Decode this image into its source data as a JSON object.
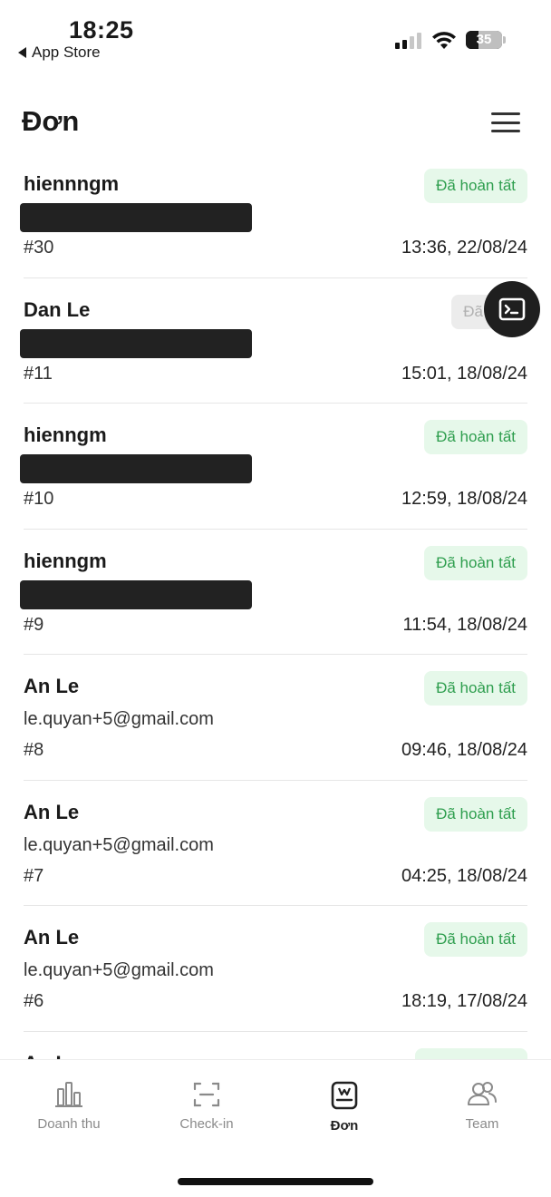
{
  "status_bar": {
    "time": "18:25",
    "back_app": "App Store",
    "battery": "35"
  },
  "header": {
    "title": "Đơn",
    "menu_icon": "hamburger-menu-icon"
  },
  "orders": [
    {
      "name": "hiennngm",
      "email": "",
      "email_redacted": true,
      "id": "#30",
      "time": "13:36, 22/08/24",
      "status": "Đã hoàn tất"
    },
    {
      "name": "Dan Le",
      "email": "",
      "email_redacted": true,
      "id": "#11",
      "time": "15:01, 18/08/24",
      "status": "Đã"
    },
    {
      "name": "hienngm",
      "email": "",
      "email_redacted": true,
      "id": "#10",
      "time": "12:59, 18/08/24",
      "status": "Đã hoàn tất"
    },
    {
      "name": "hienngm",
      "email": "",
      "email_redacted": true,
      "id": "#9",
      "time": "11:54, 18/08/24",
      "status": "Đã hoàn tất"
    },
    {
      "name": "An Le",
      "email": "le.quyan+5@gmail.com",
      "email_redacted": false,
      "id": "#8",
      "time": "09:46, 18/08/24",
      "status": "Đã hoàn tất"
    },
    {
      "name": "An Le",
      "email": "le.quyan+5@gmail.com",
      "email_redacted": false,
      "id": "#7",
      "time": "04:25, 18/08/24",
      "status": "Đã hoàn tất"
    },
    {
      "name": "An Le",
      "email": "le.quyan+5@gmail.com",
      "email_redacted": false,
      "id": "#6",
      "time": "18:19, 17/08/24",
      "status": "Đã hoàn tất"
    },
    {
      "name": "An Le",
      "email": "",
      "email_redacted": false,
      "id": "",
      "time": "",
      "status": ""
    }
  ],
  "tabs": [
    {
      "label": "Doanh thu",
      "icon": "bar-chart-icon",
      "active": false
    },
    {
      "label": "Check-in",
      "icon": "scan-icon",
      "active": false
    },
    {
      "label": "Đơn",
      "icon": "order-doc-icon",
      "active": true
    },
    {
      "label": "Team",
      "icon": "team-icon",
      "active": false
    }
  ],
  "colors": {
    "status_bg": "#e6f8ea",
    "status_text": "#2e9e4e",
    "fab": "#1f1f1f"
  }
}
